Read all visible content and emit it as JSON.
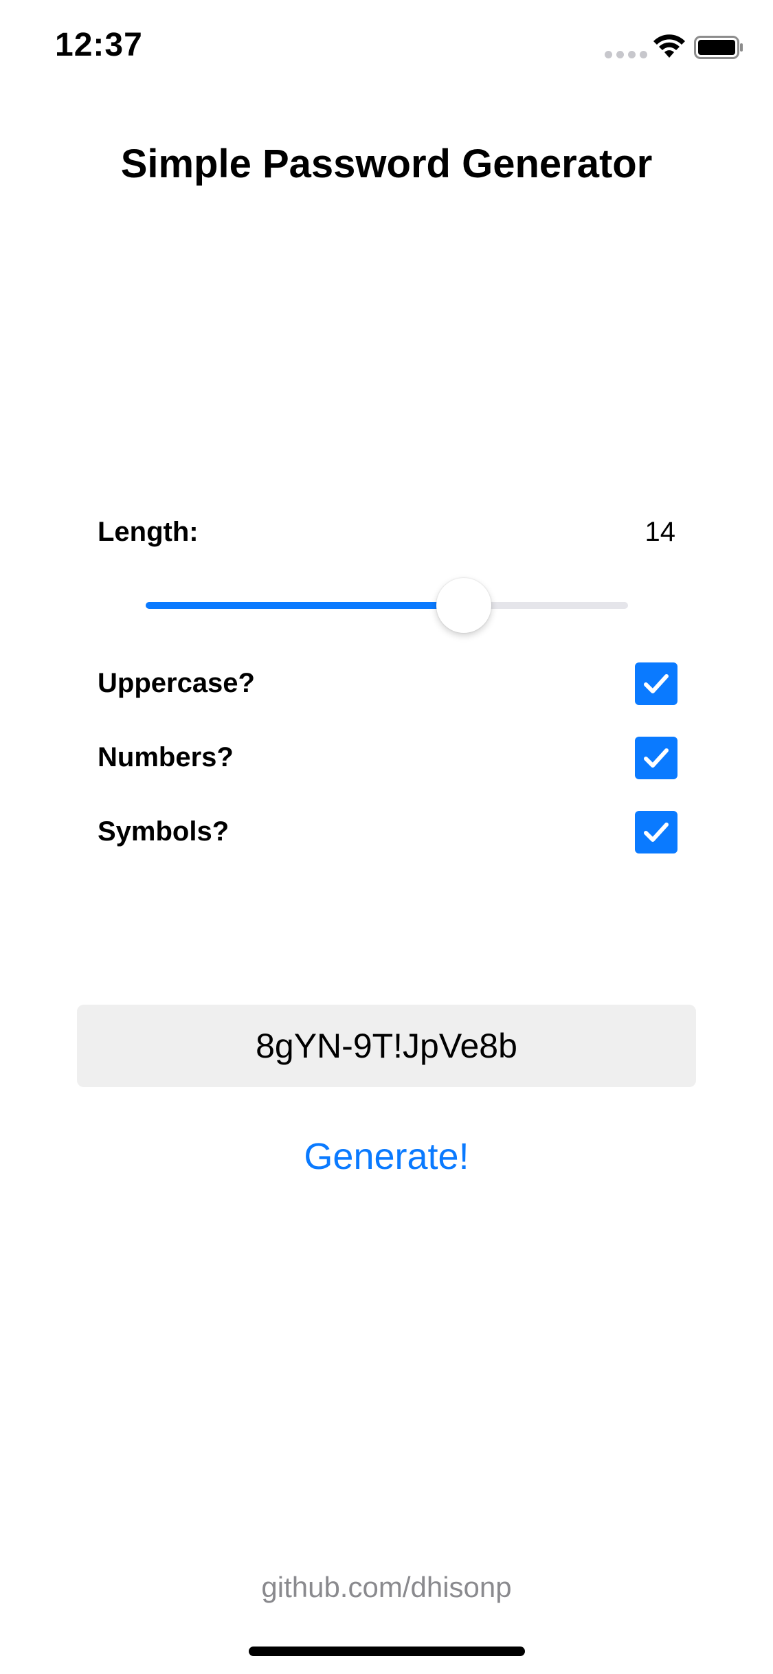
{
  "status_bar": {
    "time": "12:37",
    "icons": [
      "signal-dots-icon",
      "wifi-icon",
      "battery-icon"
    ]
  },
  "app": {
    "title": "Simple Password Generator"
  },
  "length": {
    "label": "Length:",
    "value": "14",
    "slider_fraction": 0.66
  },
  "options": [
    {
      "label": "Uppercase?",
      "checked": true
    },
    {
      "label": "Numbers?",
      "checked": true
    },
    {
      "label": "Symbols?",
      "checked": true
    }
  ],
  "password": {
    "value": "8gYN-9T!JpVe8b"
  },
  "generate": {
    "label": "Generate!"
  },
  "footer": {
    "link": "github.com/dhisonp"
  },
  "colors": {
    "accent": "#0a7aff",
    "field_bg": "#efefef",
    "footer_text": "#8a8a8e"
  }
}
